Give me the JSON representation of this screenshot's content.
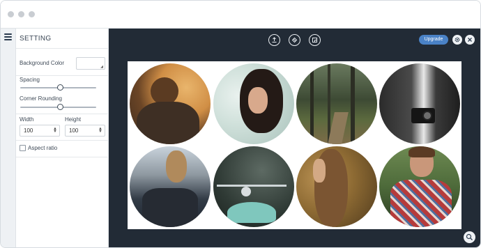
{
  "panel": {
    "title": "SETTING",
    "background_color_label": "Background Color",
    "spacing_label": "Spacing",
    "spacing_value": 0.53,
    "corner_rounding_label": "Corner Rounding",
    "corner_rounding_value": 0.53,
    "width_label": "Width",
    "width_value": "100",
    "height_label": "Height",
    "height_value": "100",
    "aspect_ratio_label": "Aspect ratio",
    "aspect_ratio_checked": false
  },
  "toolbar": {
    "upgrade_label": "Upgrade",
    "icons": [
      "upload-icon",
      "shuffle-icon",
      "grid-edit-icon"
    ]
  },
  "collage": {
    "photos": [
      {
        "name": "man-with-scarf-photo"
      },
      {
        "name": "woman-curly-hair-photo"
      },
      {
        "name": "forest-path-photo"
      },
      {
        "name": "man-with-camera-photo"
      },
      {
        "name": "woman-sitting-photo"
      },
      {
        "name": "motorcycle-photo"
      },
      {
        "name": "woman-profile-photo"
      },
      {
        "name": "man-plaid-shirt-photo"
      }
    ]
  },
  "colors": {
    "canvas_bg": "#222b36",
    "accent": "#4a82c6"
  }
}
